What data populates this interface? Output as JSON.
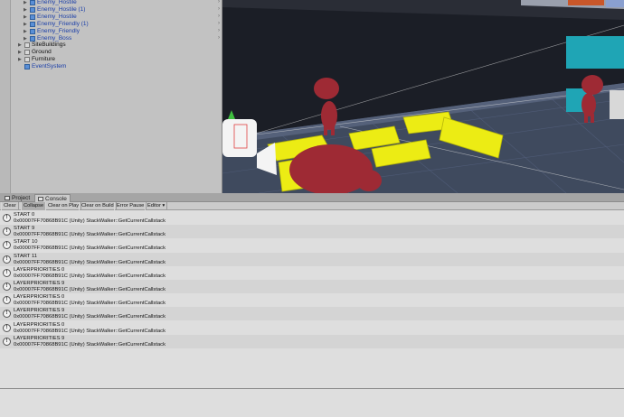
{
  "hierarchy": {
    "items": [
      {
        "label": "Enemy_Hostile",
        "color": "blue",
        "folded": true
      },
      {
        "label": "Enemy_Hostile (1)",
        "color": "blue",
        "folded": true
      },
      {
        "label": "Enemy_Hostile",
        "color": "blue",
        "folded": true
      },
      {
        "label": "Enemy_Friendly (1)",
        "color": "blue",
        "folded": true
      },
      {
        "label": "Enemy_Friendly",
        "color": "blue",
        "folded": true
      },
      {
        "label": "Enemy_Boss",
        "color": "blue",
        "folded": true
      },
      {
        "label": "SiteBuildings",
        "color": "black",
        "folded": true
      },
      {
        "label": "Ground",
        "color": "black",
        "folded": true
      },
      {
        "label": "Furniture",
        "color": "black",
        "folded": true
      },
      {
        "label": "EventSystem",
        "color": "blue",
        "folded": false
      }
    ]
  },
  "tabs": [
    {
      "label": "Project",
      "active": false
    },
    {
      "label": "Console",
      "active": true
    }
  ],
  "toolbar": {
    "clear": "Clear",
    "collapse": "Collapse",
    "clear_on_play": "Clear on Play",
    "clear_on_build": "Clear on Build",
    "error_pause": "Error Pause",
    "editor": "Editor",
    "editor_arrow": "▾"
  },
  "console": {
    "icon_glyph": "!",
    "entries": [
      {
        "message": "START 0",
        "trace": "0x00007FF70868B91C (Unity) StackWalker::GetCurrentCallstack"
      },
      {
        "message": "START 9",
        "trace": "0x00007FF70868B91C (Unity) StackWalker::GetCurrentCallstack"
      },
      {
        "message": "START 10",
        "trace": "0x00007FF70868B91C (Unity) StackWalker::GetCurrentCallstack"
      },
      {
        "message": "START 11",
        "trace": "0x00007FF70868B91C (Unity) StackWalker::GetCurrentCallstack"
      },
      {
        "message": "LAYERPRIORITIES 0",
        "trace": "0x00007FF70868B91C (Unity) StackWalker::GetCurrentCallstack"
      },
      {
        "message": "LAYERPRIORITIES 9",
        "trace": "0x00007FF70868B91C (Unity) StackWalker::GetCurrentCallstack"
      },
      {
        "message": "LAYERPRIORITIES 0",
        "trace": "0x00007FF70868B91C (Unity) StackWalker::GetCurrentCallstack"
      },
      {
        "message": "LAYERPRIORITIES 9",
        "trace": "0x00007FF70868B91C (Unity) StackWalker::GetCurrentCallstack"
      },
      {
        "message": "LAYERPRIORITIES 0",
        "trace": "0x00007FF70868B91C (Unity) StackWalker::GetCurrentCallstack"
      },
      {
        "message": "LAYERPRIORITIES 9",
        "trace": "0x00007FF70868B91C (Unity) StackWalker::GetCurrentCallstack"
      }
    ]
  },
  "colors": {
    "hierarchy_blue": "#1a3ea8",
    "scene_sky": "#1b1e26",
    "scene_floor": "#3f4a5e",
    "yellow_blocks": "#ecec14",
    "character_red": "#9e2a34",
    "cyan_blocks": "#1fa5b5"
  }
}
